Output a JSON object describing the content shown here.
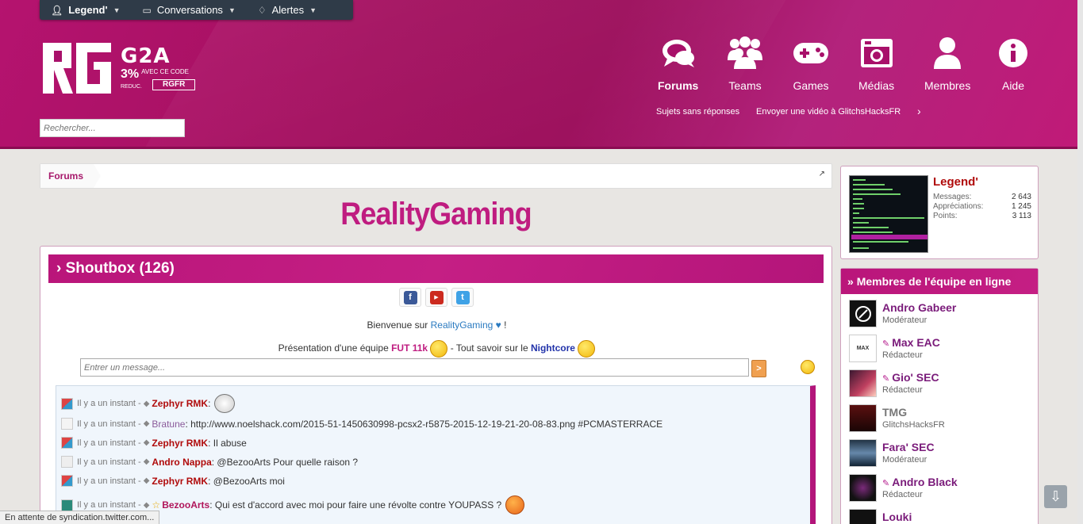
{
  "topbar": {
    "user": "Legend'",
    "conversations": "Conversations",
    "alerts": "Alertes"
  },
  "promo": {
    "brand": "G2A",
    "percent": "3%",
    "line1": "AVEC CE CODE",
    "reduc": "REDUC.",
    "code": "RGFR"
  },
  "search": {
    "placeholder": "Rechercher..."
  },
  "nav": [
    {
      "label": "Forums"
    },
    {
      "label": "Teams"
    },
    {
      "label": "Games"
    },
    {
      "label": "Médias"
    },
    {
      "label": "Membres"
    },
    {
      "label": "Aide"
    }
  ],
  "subnav": {
    "unanswered": "Sujets sans réponses",
    "send_video": "Envoyer une vidéo à GlitchsHacksFR"
  },
  "breadcrumb": {
    "forums": "Forums"
  },
  "site_title": "RealityGaming",
  "shoutbox": {
    "title": "Shoutbox (126)",
    "welcome_prefix": "Bienvenue sur ",
    "welcome_site": "RealityGaming",
    "welcome_suffix": " !",
    "pres_prefix": "Présentation d'une équipe ",
    "pres_fut": "FUT 11k",
    "pres_mid": " - Tout savoir sur le ",
    "pres_nc": "Nightcore",
    "input_placeholder": "Entrer un message...",
    "send": ">",
    "messages": [
      {
        "time": "Il y a un instant -",
        "user": "Zephyr RMK",
        "text": ":"
      },
      {
        "time": "Il y a un instant -",
        "user": "Bratune",
        "text": ": http://www.noelshack.com/2015-51-1450630998-pcsx2-r5875-2015-12-19-21-20-08-83.png #PCMASTERRACE"
      },
      {
        "time": "Il y a un instant -",
        "user": "Zephyr RMK",
        "text": ": Il abuse"
      },
      {
        "time": "Il y a un instant -",
        "user": "Andro Nappa",
        "text": ": @BezooArts Pour quelle raison ?"
      },
      {
        "time": "Il y a un instant -",
        "user": "Zephyr RMK",
        "text": ": @BezooArts moi"
      },
      {
        "time": "Il y a un instant -",
        "user": "BezooArts",
        "text": ": Qui est d'accord avec moi pour faire une révolte contre YOUPASS ?"
      }
    ]
  },
  "profile": {
    "name": "Legend'",
    "messages_label": "Messages:",
    "messages": "2 643",
    "likes_label": "Appréciations:",
    "likes": "1 245",
    "points_label": "Points:",
    "points": "3 113"
  },
  "team": {
    "title": "Membres de l'équipe en ligne",
    "members": [
      {
        "name": "Andro Gabeer",
        "role": "Modérateur"
      },
      {
        "name": "Max EAC",
        "role": "Rédacteur"
      },
      {
        "name": "Gio' SEC",
        "role": "Rédacteur"
      },
      {
        "name": "TMG",
        "role": "GlitchsHacksFR"
      },
      {
        "name": "Fara' SEC",
        "role": "Modérateur"
      },
      {
        "name": "Andro Black",
        "role": "Rédacteur"
      },
      {
        "name": "Louki",
        "role": ""
      }
    ]
  },
  "status": "En attente de syndication.twitter.com..."
}
